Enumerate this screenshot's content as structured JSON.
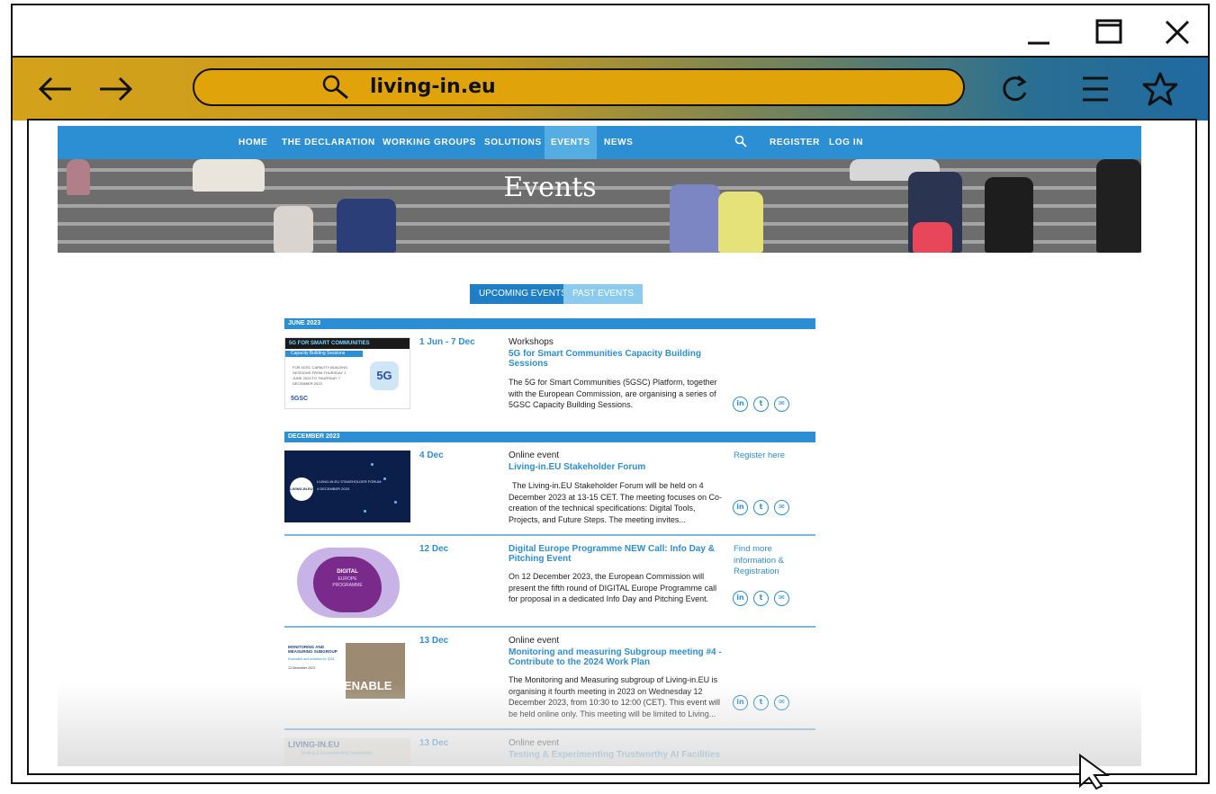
{
  "browser": {
    "url": "living-in.eu",
    "icons": {
      "minimize": "minimize-icon",
      "maximize": "maximize-icon",
      "close": "close-icon",
      "back": "back-arrow-icon",
      "forward": "forward-arrow-icon",
      "search": "search-icon",
      "reload": "reload-icon",
      "menu": "hamburger-menu-icon",
      "bookmark": "star-icon"
    }
  },
  "nav": {
    "items": [
      "HOME",
      "THE DECLARATION",
      "WORKING GROUPS",
      "SOLUTIONS",
      "EVENTS",
      "NEWS"
    ],
    "active": "EVENTS",
    "search_icon": "search-icon",
    "register": "REGISTER",
    "login": "LOG IN"
  },
  "hero": {
    "title": "Events"
  },
  "tabs": {
    "upcoming": "UPCOMING EVENTS",
    "past": "PAST EVENTS"
  },
  "months": [
    "JUNE 2023",
    "DECEMBER 2023"
  ],
  "events": [
    {
      "date": "1 Jun - 7 Dec",
      "type": "Workshops",
      "title": "5G for Smart Communities Capacity Building Sessions",
      "desc": "The 5G for Smart Communities (5GSC) Platform, together with the European Commission, are organising a series of 5GSC Capacity Building Sessions.",
      "link": "",
      "thumb": {
        "header": "5G FOR SMART COMMUNITIES",
        "sub": "Capacity Building Sessions",
        "lines": "FOR 5GSC CAPACITY BUILDING SESSIONS FROM THURSDAY 1 JUNE 2023 TO THURSDAY 7 DECEMBER 2023",
        "brand": "5GSC",
        "badge": "5G"
      }
    },
    {
      "date": "4 Dec",
      "type": "Online event",
      "title": "Living-in.EU Stakeholder Forum",
      "desc": "The Living-in.EU Stakeholder Forum will be held on 4 December 2023 at 13-15 CET. The meeting focuses on Co-creation of the technical specifications: Digital Tools, Projects, and Future Steps. The meeting invites...",
      "link": "Register here",
      "thumb": {
        "logo": "LIVING-IN.EU",
        "line1": "LIVING-IN.EU STAKEHOLDER FORUM",
        "line2": "4 DECEMBER 2023"
      }
    },
    {
      "date": "12 Dec",
      "type": "",
      "title": "Digital Europe Programme NEW Call: Info Day & Pitching Event",
      "desc": "On 12 December 2023, the European Commission will present the fifth round of DIGITAL Europe Programme call for proposal in a dedicated Info Day and Pitching Event.",
      "link": "Find more information & Registration",
      "thumb": {
        "word1": "DIGITAL",
        "word2": "EUROPE",
        "word3": "PROGRAMME"
      }
    },
    {
      "date": "13 Dec",
      "type": "Online event",
      "title": "Monitoring and measuring Subgroup meeting #4 - Contribute to the 2024 Work Plan",
      "desc": "The Monitoring and Measuring subgroup of Living-in.EU is organising it fourth meeting in 2023 on Wednesday 12 December 2023, from 10:30 to 12:00 (CET). This event will be held online only. This meeting will be limited to Living...",
      "link": "",
      "thumb": {
        "header": "MONITORING AND MEASURING SUBGROUP",
        "sub": "Evaluation and activities for 2024",
        "date": "13 December 2023",
        "brand": "ENABLE"
      }
    },
    {
      "date": "13 Dec",
      "type": "Online event",
      "title": "Testing & Experimenting Trustworthy AI Facilities",
      "desc": "",
      "link": "",
      "thumb": {
        "logo": "LIVING-IN.EU",
        "sub": "Testing & Experimenting trustworthy"
      }
    }
  ],
  "share_icons": [
    "linkedin-icon",
    "twitter-icon",
    "email-icon"
  ],
  "share_glyphs": [
    "in",
    "t",
    "✉"
  ],
  "colors": {
    "accent": "#2c8fd3",
    "nav": "#2c8fd3",
    "tab_past": "#8ccbee",
    "url_bar": "#e0a40a"
  }
}
